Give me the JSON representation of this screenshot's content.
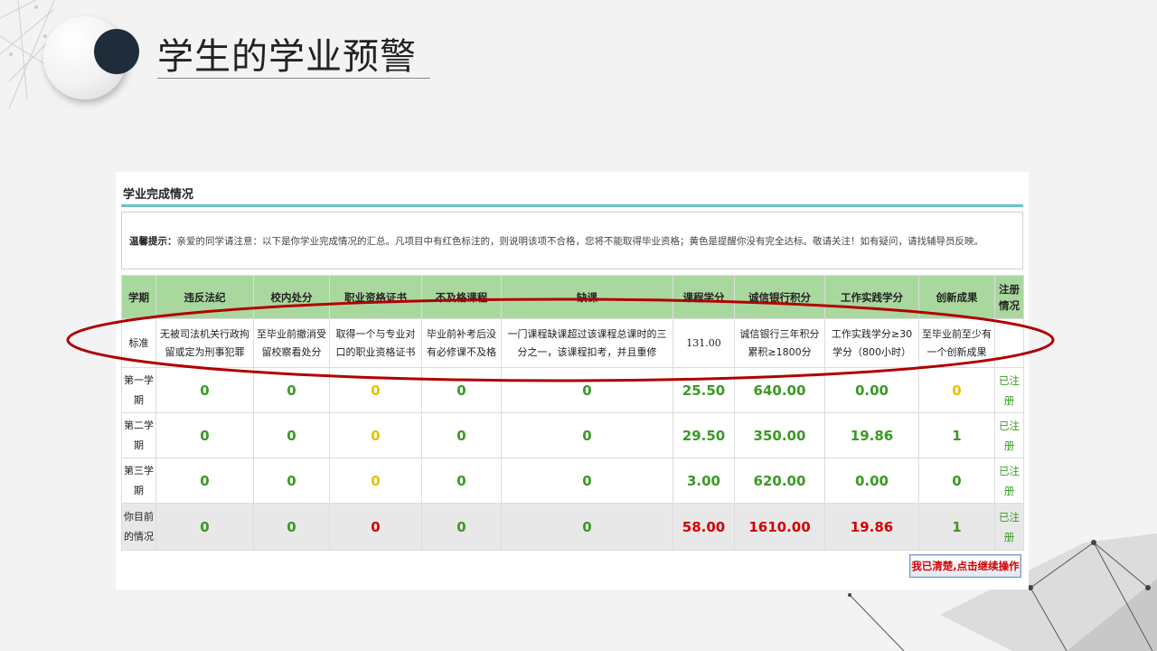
{
  "slide": {
    "title": "学生的学业预警"
  },
  "panel": {
    "section_title": "学业完成情况",
    "notice_label": "温馨提示：",
    "notice_text": "亲爱的同学请注意：以下是你学业完成情况的汇总。凡项目中有红色标注的，则说明该项不合格，您将不能取得毕业资格；黄色是提醒你没有完全达标。敬请关注！如有疑问，请找辅导员反映。"
  },
  "table": {
    "headers": [
      "学期",
      "违反法纪",
      "校内处分",
      "职业资格证书",
      "不及格课程",
      "缺课",
      "课程学分",
      "诚信银行积分",
      "工作实践学分",
      "创新成果",
      "注册情况"
    ],
    "standard_row": {
      "term": "标准",
      "cells": [
        "无被司法机关行政拘留或定为刑事犯罪",
        "至毕业前撤消受留校察看处分",
        "取得一个与专业对口的职业资格证书",
        "毕业前补考后没有必修课不及格",
        "一门课程缺课超过该课程总课时的三分之一，该课程扣考，并且重修",
        "131.00",
        "诚信银行三年积分累积≥1800分",
        "工作实践学分≥30学分（800小时）",
        "至毕业前至少有一个创新成果",
        ""
      ]
    },
    "rows": [
      {
        "term": "第一学期",
        "values": [
          "0",
          "0",
          "0",
          "0",
          "0",
          "25.50",
          "640.00",
          "0.00",
          "0"
        ],
        "colors": [
          "#3a9a24",
          "#3a9a24",
          "#e6c200",
          "#3a9a24",
          "#3a9a24",
          "#3a9a24",
          "#3a9a24",
          "#3a9a24",
          "#e6c200"
        ],
        "reg": "已注册"
      },
      {
        "term": "第二学期",
        "values": [
          "0",
          "0",
          "0",
          "0",
          "0",
          "29.50",
          "350.00",
          "19.86",
          "1"
        ],
        "colors": [
          "#3a9a24",
          "#3a9a24",
          "#e6c200",
          "#3a9a24",
          "#3a9a24",
          "#3a9a24",
          "#3a9a24",
          "#3a9a24",
          "#3a9a24"
        ],
        "reg": "已注册"
      },
      {
        "term": "第三学期",
        "values": [
          "0",
          "0",
          "0",
          "0",
          "0",
          "3.00",
          "620.00",
          "0.00",
          "0"
        ],
        "colors": [
          "#3a9a24",
          "#3a9a24",
          "#e6c200",
          "#3a9a24",
          "#3a9a24",
          "#3a9a24",
          "#3a9a24",
          "#3a9a24",
          "#3a9a24"
        ],
        "reg": "已注册"
      }
    ],
    "current_row": {
      "term": "你目前的情况",
      "values": [
        "0",
        "0",
        "0",
        "0",
        "0",
        "58.00",
        "1610.00",
        "19.86",
        "1"
      ],
      "colors": [
        "#3a9a24",
        "#3a9a24",
        "#d40000",
        "#3a9a24",
        "#3a9a24",
        "#d40000",
        "#d40000",
        "#d40000",
        "#3a9a24"
      ],
      "reg": "已注册"
    }
  },
  "continue_button": {
    "label": "我已清楚,点击继续操作"
  },
  "colors": {
    "header_bg": "#a9d89f",
    "accent_rule": "#63c7c2",
    "ok": "#3a9a24",
    "warn": "#e6c200",
    "fail": "#d40000",
    "highlight_ellipse": "#b00000"
  }
}
